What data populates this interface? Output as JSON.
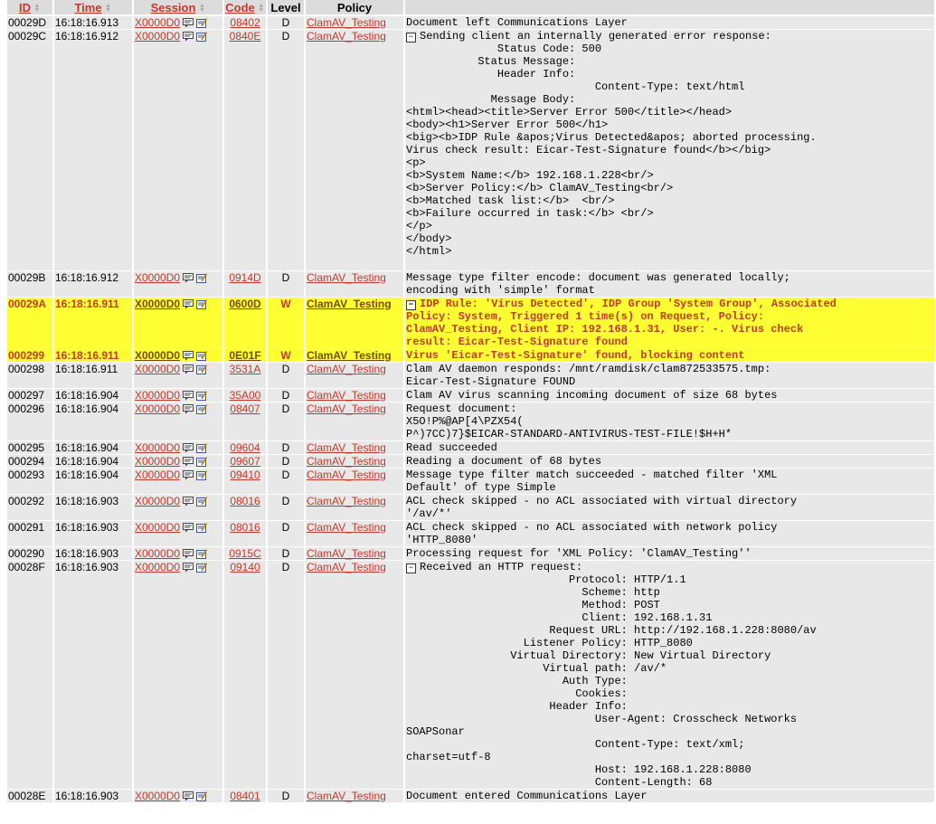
{
  "columns": {
    "id": "ID",
    "time": "Time",
    "session": "Session",
    "code": "Code",
    "level": "Level",
    "policy": "Policy"
  },
  "icons": [
    "comment-icon",
    "edit-note-icon"
  ],
  "colors": {
    "warn_bg": "#ffff33",
    "link": "#c0392b",
    "row_bg": "#e8e8e8"
  },
  "rows": [
    {
      "id": "00029D",
      "time": "16:18:16.913",
      "session": "X0000D0",
      "code": "08402",
      "level": "D",
      "policy": "ClamAV_Testing",
      "warn": false,
      "collapsible": false,
      "message": "Document left Communications Layer"
    },
    {
      "id": "00029C",
      "time": "16:18:16.912",
      "session": "X0000D0",
      "code": "0840E",
      "level": "D",
      "policy": "ClamAV_Testing",
      "warn": false,
      "collapsible": true,
      "message": "Sending client an internally generated error response:\n              Status Code: 500\n           Status Message:\n              Header Info:\n                             Content-Type: text/html\n             Message Body:\n<html><head><title>Server Error 500</title></head>\n<body><h1>Server Error 500</h1>\n<big><b>IDP Rule &apos;Virus Detected&apos; aborted processing.\nVirus check result: Eicar-Test-Signature found</b></big>\n<p>\n<b>System Name:</b> 192.168.1.228<br/>\n<b>Server Policy:</b> ClamAV_Testing<br/>\n<b>Matched task list:</b>  <br/>\n<b>Failure occurred in task:</b> <br/>\n</p>\n</body>\n</html>\n "
    },
    {
      "id": "00029B",
      "time": "16:18:16.912",
      "session": "X0000D0",
      "code": "0914D",
      "level": "D",
      "policy": "ClamAV_Testing",
      "warn": false,
      "collapsible": false,
      "message": "Message type filter encode: document was generated locally;\nencoding with 'simple' format"
    },
    {
      "id": "00029A",
      "time": "16:18:16.911",
      "session": "X0000D0",
      "code": "0600D",
      "level": "W",
      "policy": "ClamAV_Testing",
      "warn": true,
      "collapsible": true,
      "message": "IDP Rule: 'Virus Detected', IDP Group 'System Group', Associated\nPolicy: System, Triggered 1 time(s) on Request, Policy:\nClamAV_Testing, Client IP: 192.168.1.31, User: -. Virus check\nresult: Eicar-Test-Signature found"
    },
    {
      "id": "000299",
      "time": "16:18:16.911",
      "session": "X0000D0",
      "code": "0E01F",
      "level": "W",
      "policy": "ClamAV_Testing",
      "warn": true,
      "collapsible": false,
      "message": "Virus 'Eicar-Test-Signature' found, blocking content"
    },
    {
      "id": "000298",
      "time": "16:18:16.911",
      "session": "X0000D0",
      "code": "3531A",
      "level": "D",
      "policy": "ClamAV_Testing",
      "warn": false,
      "collapsible": false,
      "message": "Clam AV daemon responds: /mnt/ramdisk/clam872533575.tmp:\nEicar-Test-Signature FOUND"
    },
    {
      "id": "000297",
      "time": "16:18:16.904",
      "session": "X0000D0",
      "code": "35A00",
      "level": "D",
      "policy": "ClamAV_Testing",
      "warn": false,
      "collapsible": false,
      "message": "Clam AV virus scanning incoming document of size 68 bytes"
    },
    {
      "id": "000296",
      "time": "16:18:16.904",
      "session": "X0000D0",
      "code": "08407",
      "level": "D",
      "policy": "ClamAV_Testing",
      "warn": false,
      "collapsible": false,
      "message": "Request document:\nX5O!P%@AP[4\\PZX54(\nP^)7CC)7}$EICAR-STANDARD-ANTIVIRUS-TEST-FILE!$H+H*"
    },
    {
      "id": "000295",
      "time": "16:18:16.904",
      "session": "X0000D0",
      "code": "09604",
      "level": "D",
      "policy": "ClamAV_Testing",
      "warn": false,
      "collapsible": false,
      "message": "Read succeeded"
    },
    {
      "id": "000294",
      "time": "16:18:16.904",
      "session": "X0000D0",
      "code": "09607",
      "level": "D",
      "policy": "ClamAV_Testing",
      "warn": false,
      "collapsible": false,
      "message": "Reading a document of 68 bytes"
    },
    {
      "id": "000293",
      "time": "16:18:16.904",
      "session": "X0000D0",
      "code": "09410",
      "level": "D",
      "policy": "ClamAV_Testing",
      "warn": false,
      "collapsible": false,
      "message": "Message type filter match succeeded - matched filter 'XML\nDefault' of type Simple"
    },
    {
      "id": "000292",
      "time": "16:18:16.903",
      "session": "X0000D0",
      "code": "08016",
      "level": "D",
      "policy": "ClamAV_Testing",
      "warn": false,
      "collapsible": false,
      "message": "ACL check skipped - no ACL associated with virtual directory\n'/av/*'"
    },
    {
      "id": "000291",
      "time": "16:18:16.903",
      "session": "X0000D0",
      "code": "08016",
      "level": "D",
      "policy": "ClamAV_Testing",
      "warn": false,
      "collapsible": false,
      "message": "ACL check skipped - no ACL associated with network policy\n'HTTP_8080'"
    },
    {
      "id": "000290",
      "time": "16:18:16.903",
      "session": "X0000D0",
      "code": "0915C",
      "level": "D",
      "policy": "ClamAV_Testing",
      "warn": false,
      "collapsible": false,
      "message": "Processing request for 'XML Policy: 'ClamAV_Testing''"
    },
    {
      "id": "00028F",
      "time": "16:18:16.903",
      "session": "X0000D0",
      "code": "09140",
      "level": "D",
      "policy": "ClamAV_Testing",
      "warn": false,
      "collapsible": true,
      "message": "Received an HTTP request:\n                         Protocol: HTTP/1.1\n                           Scheme: http\n                           Method: POST\n                           Client: 192.168.1.31\n                      Request URL: http://192.168.1.228:8080/av\n                  Listener Policy: HTTP_8080\n                Virtual Directory: New Virtual Directory\n                     Virtual path: /av/*\n                        Auth Type:\n                          Cookies:\n                      Header Info:\n                             User-Agent: Crosscheck Networks\nSOAPSonar\n                             Content-Type: text/xml;\ncharset=utf-8\n                             Host: 192.168.1.228:8080\n                             Content-Length: 68"
    },
    {
      "id": "00028E",
      "time": "16:18:16.903",
      "session": "X0000D0",
      "code": "08401",
      "level": "D",
      "policy": "ClamAV_Testing",
      "warn": false,
      "collapsible": false,
      "message": "Document entered Communications Layer"
    }
  ]
}
